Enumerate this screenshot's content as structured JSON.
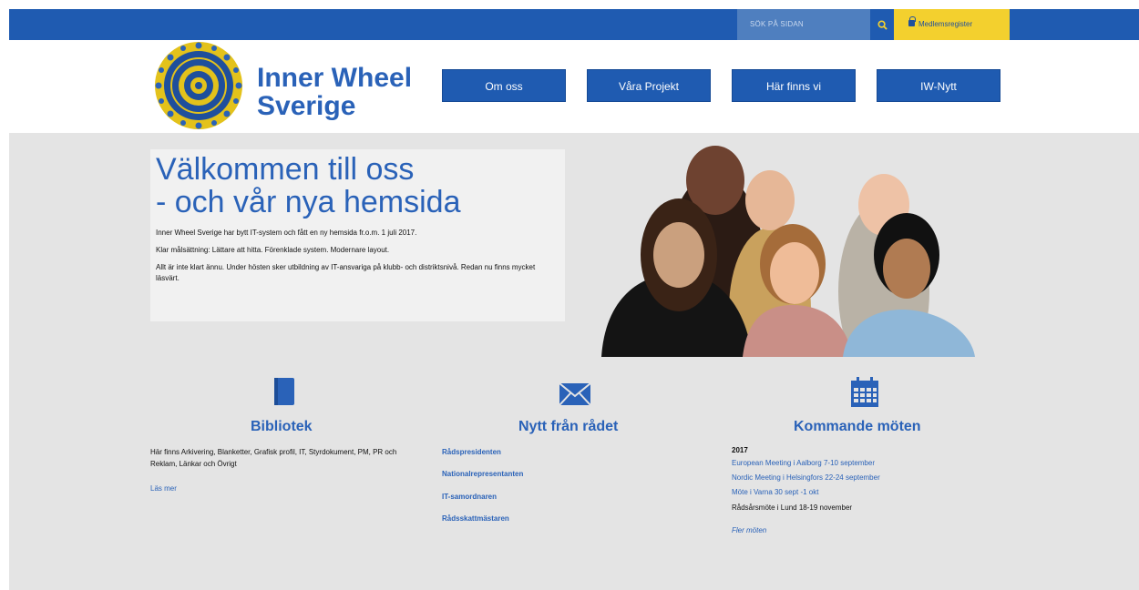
{
  "topbar": {
    "search_placeholder": "SÖK PÅ SIDAN",
    "search_icon": "search-icon",
    "member_label": "Medlemsregister",
    "member_icon": "lock-icon"
  },
  "header": {
    "brand_line1": "Inner Wheel",
    "brand_line2": "Sverige",
    "nav": [
      {
        "label": "Om oss"
      },
      {
        "label": "Våra Projekt"
      },
      {
        "label": "Här finns vi"
      },
      {
        "label": "IW-Nytt"
      }
    ]
  },
  "welcome": {
    "title_line1": "Välkommen till oss",
    "title_line2": "- och vår nya hemsida",
    "p1": "Inner Wheel Sverige har bytt IT-system och fått en ny hemsida fr.o.m. 1 juli 2017.",
    "p2": "Klar målsättning: Lättare att hitta. Förenklade system. Modernare layout.",
    "p3": "Allt är inte klart ännu. Under hösten sker utbildning av IT-ansvariga på klubb- och distriktsnivå. Redan nu finns mycket läsvärt."
  },
  "library": {
    "icon": "book-icon",
    "title": "Bibliotek",
    "text": "Här finns Arkivering, Blanketter, Grafisk profil, IT, Styrdokument, PM, PR och Reklam, Länkar och Övrigt",
    "link": "Läs mer"
  },
  "council": {
    "icon": "envelope-icon",
    "title": "Nytt från rådet",
    "links": [
      "Rådspresidenten",
      "Nationalrepresentanten",
      "IT-samordnaren",
      "Rådsskattmästaren"
    ]
  },
  "meetings": {
    "icon": "calendar-icon",
    "title": "Kommande möten",
    "year": "2017",
    "items": [
      {
        "text": "European Meeting i Aalborg 7-10 september"
      },
      {
        "text": "Nordic Meeting i Helsingfors 22-24 september"
      },
      {
        "text": "Möte i Varna 30 sept -1 okt"
      },
      {
        "text": "Rådsårsmöte i Lund 18-19 november"
      }
    ],
    "more": "Fler möten"
  },
  "colors": {
    "primary": "#1f5bb1",
    "title_blue": "#2a62b8",
    "yellow": "#f3d02e",
    "background": "#e4e4e4"
  }
}
